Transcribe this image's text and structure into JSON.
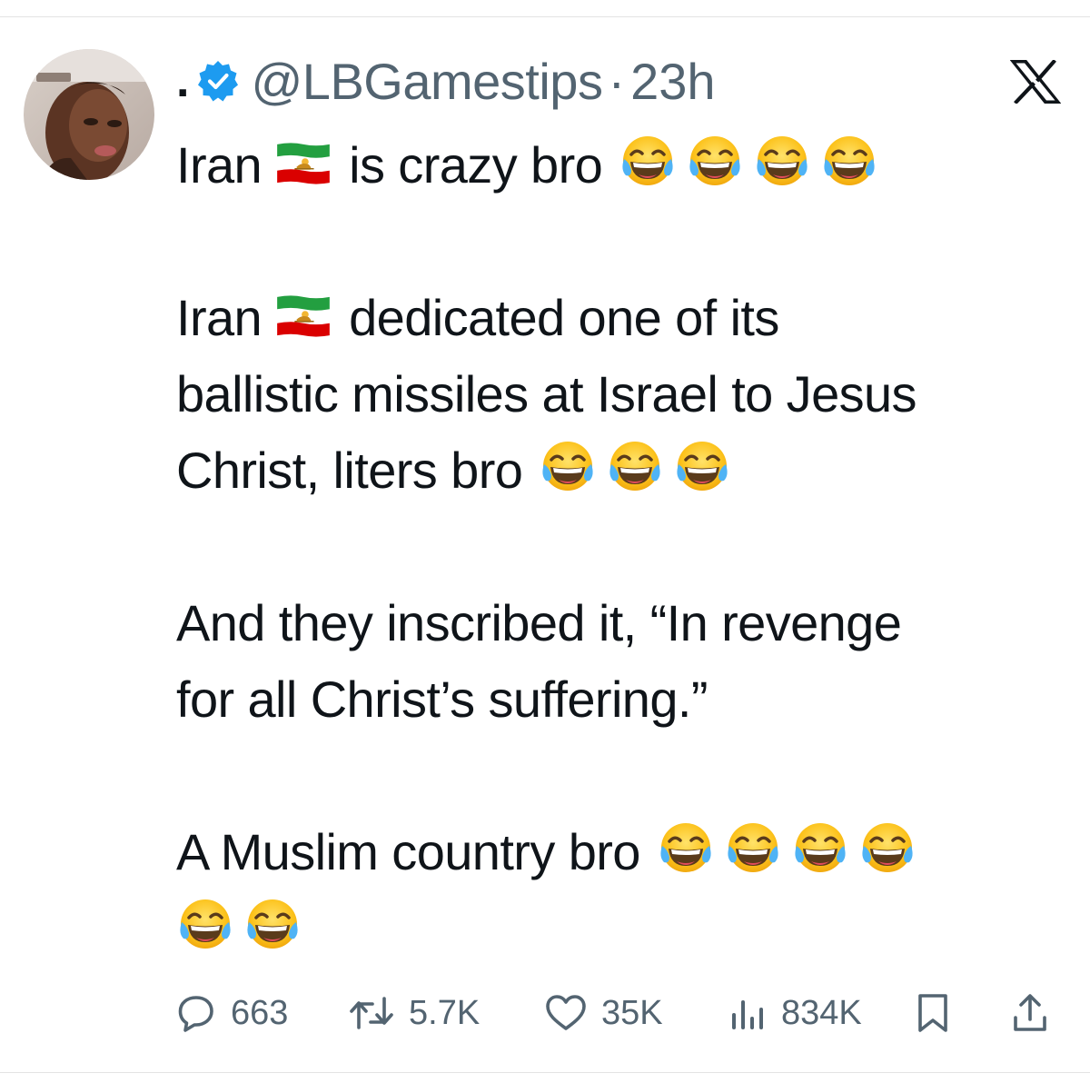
{
  "tweet": {
    "display_name": ".",
    "handle": "@LBGamestips",
    "separator": "·",
    "time": "23h",
    "text": {
      "line1": "Iran",
      "line1b": "is crazy bro",
      "line2": "Iran",
      "line2b": "dedicated one of its",
      "line3": "ballistic missiles at Israel to Jesus",
      "line4": "Christ, liters bro",
      "line5": "And they inscribed it, “In revenge",
      "line6": "for all Christ’s suffering.”",
      "line7": "A Muslim country bro"
    },
    "emoji": {
      "flag": "iran-lion-and-sun-flag",
      "laugh": "face-with-tears-of-joy"
    }
  },
  "actions": {
    "replies": "663",
    "reposts": "5.7K",
    "likes": "35K",
    "views": "834K"
  },
  "colors": {
    "text": "#0f1419",
    "secondary": "#536471",
    "verified": "#1d9bf0"
  }
}
